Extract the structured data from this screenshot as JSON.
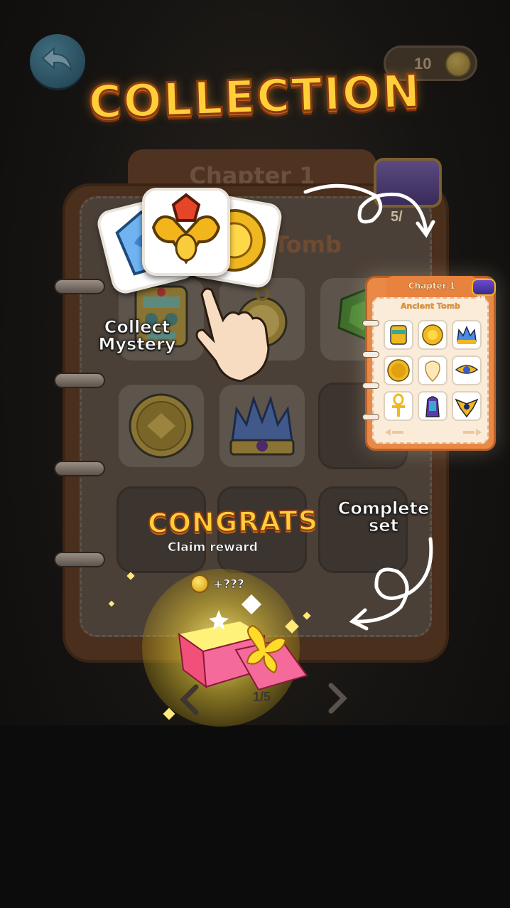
{
  "header": {
    "title": "COLLECTION",
    "coins": "10"
  },
  "book": {
    "chapter_title": "Chapter 1",
    "section_title": "Tomb",
    "chest_progress": "5/"
  },
  "tutorial": {
    "collect_label_line1": "Collect",
    "collect_label_line2": "Mystery",
    "complete_label_line1": "Complete",
    "complete_label_line2": "set"
  },
  "mini_book": {
    "chapter_title": "Chapter 1",
    "section_title": "Ancient Tomb",
    "progress": "9/9",
    "items": [
      "tiki-mask-icon",
      "sun-medallion-icon",
      "blue-crown-icon",
      "gold-coin-icon",
      "pearl-shell-icon",
      "eye-of-horus-icon",
      "ankh-icon",
      "pharaoh-icon",
      "winged-amulet-icon"
    ]
  },
  "reward": {
    "congrats": "CONGRATS",
    "claim_label": "Claim reward",
    "amount": "+???"
  },
  "pager": {
    "page": "1/5"
  },
  "colors": {
    "title_gold": "#ffcf3a",
    "book_orange": "#e98945",
    "glow_yellow": "#ffe97a"
  }
}
